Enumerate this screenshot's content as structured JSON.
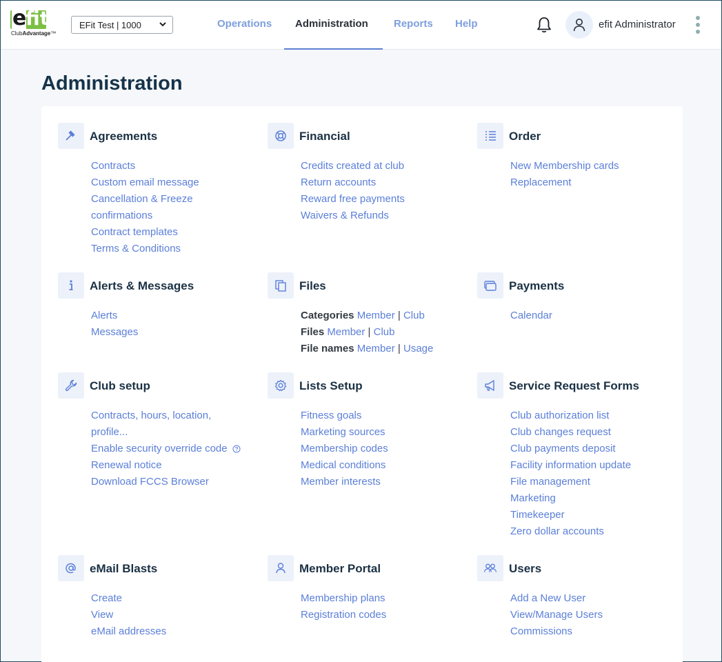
{
  "brand": {
    "logo_mark_e": "e",
    "logo_mark_fit": "fit",
    "logo_sub_1": "Club",
    "logo_sub_2": "Advantage",
    "tm": "™",
    "green": "#7bc043"
  },
  "club_selector": {
    "value": "EFit Test | 1000"
  },
  "nav": {
    "items": [
      "Operations",
      "Administration",
      "Reports",
      "Help"
    ],
    "active": "Administration"
  },
  "user": {
    "name": "efit Administrator"
  },
  "page": {
    "title": "Administration"
  },
  "sections": {
    "agreements": {
      "title": "Agreements",
      "icon": "gavel-icon",
      "links": [
        "Contracts",
        "Custom email message",
        "Cancellation & Freeze confirmations",
        "Contract templates",
        "Terms & Conditions"
      ]
    },
    "financial": {
      "title": "Financial",
      "icon": "lifebuoy-icon",
      "links": [
        "Credits created at club",
        "Return accounts",
        "Reward free payments",
        "Waivers & Refunds"
      ]
    },
    "order": {
      "title": "Order",
      "icon": "list-icon",
      "links": [
        "New Membership cards",
        "Replacement"
      ]
    },
    "alerts": {
      "title": "Alerts & Messages",
      "icon": "info-icon",
      "links": [
        "Alerts",
        "Messages"
      ]
    },
    "files": {
      "title": "Files",
      "icon": "copy-icon",
      "rows": [
        {
          "label": "Categories",
          "a": "Member",
          "b": "Club"
        },
        {
          "label": "Files",
          "a": "Member",
          "b": "Club"
        },
        {
          "label": "File names",
          "a": "Member",
          "b": "Usage"
        }
      ],
      "separator": "|"
    },
    "payments": {
      "title": "Payments",
      "icon": "cards-icon",
      "links": [
        "Calendar"
      ]
    },
    "club_setup": {
      "title": "Club setup",
      "icon": "wrench-icon",
      "links": [
        "Contracts, hours, location, profile...",
        "Enable security override code",
        "Renewal notice",
        "Download FCCS Browser"
      ]
    },
    "lists_setup": {
      "title": "Lists Setup",
      "icon": "gear-icon",
      "links": [
        "Fitness goals",
        "Marketing sources",
        "Membership codes",
        "Medical conditions",
        "Member interests"
      ]
    },
    "service_request": {
      "title": "Service Request Forms",
      "icon": "megaphone-icon",
      "links": [
        "Club authorization list",
        "Club changes request",
        "Club payments deposit",
        "Facility information update",
        "File management",
        "Marketing",
        "Timekeeper",
        "Zero dollar accounts"
      ]
    },
    "email_blasts": {
      "title": "eMail Blasts",
      "icon": "at-icon",
      "links": [
        "Create",
        "View",
        "eMail addresses"
      ]
    },
    "member_portal": {
      "title": "Member Portal",
      "icon": "person-icon",
      "links": [
        "Membership plans",
        "Registration codes"
      ]
    },
    "users": {
      "title": "Users",
      "icon": "users-icon",
      "links": [
        "Add a New User",
        "View/Manage Users",
        "Commissions"
      ]
    }
  },
  "colors": {
    "link": "#5b7fd8",
    "nav_inactive": "#7e9fdc",
    "accent": "#5b7fd0",
    "icon_bg": "#edf1fa"
  }
}
